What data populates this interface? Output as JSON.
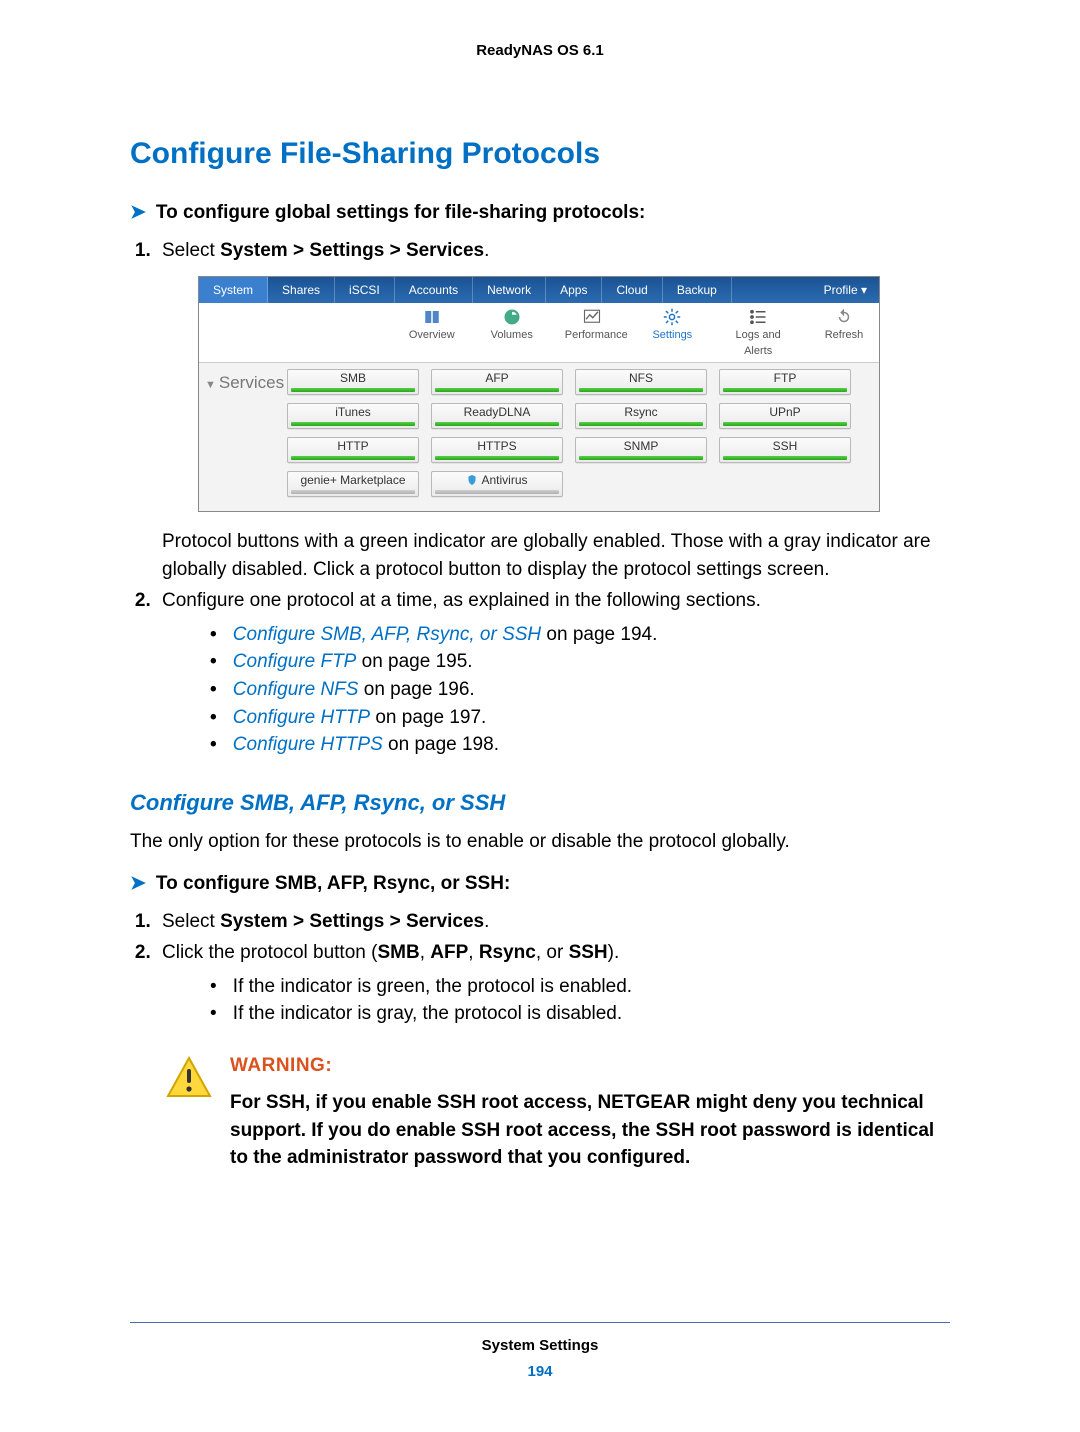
{
  "header": "ReadyNAS OS 6.1",
  "h1": "Configure File-Sharing Protocols",
  "proc1_intro": "To configure global settings for file-sharing protocols:",
  "step1_prefix": "Select ",
  "step1_bold": "System > Settings > Services",
  "step1_suffix": ".",
  "note_after_image": "Protocol buttons with a green indicator are globally enabled. Those with a gray indicator are globally disabled. Click a protocol button to display the protocol settings screen.",
  "step2": "Configure one protocol at a time, as explained in the following sections.",
  "links": [
    {
      "text": "Configure SMB, AFP, Rsync, or SSH",
      "suffix": " on page 194."
    },
    {
      "text": "Configure FTP",
      "suffix": " on page 195."
    },
    {
      "text": "Configure NFS",
      "suffix": " on page 196."
    },
    {
      "text": "Configure HTTP",
      "suffix": " on page 197."
    },
    {
      "text": "Configure HTTPS",
      "suffix": " on page 198."
    }
  ],
  "h2": "Configure SMB, AFP, Rsync, or SSH",
  "h2_body": "The only option for these protocols is to enable or disable the protocol globally.",
  "proc2_intro": "To configure SMB, AFP, Rsync, or SSH:",
  "proc2_step1_prefix": "Select ",
  "proc2_step1_bold": "System > Settings > Services",
  "proc2_step1_suffix": ".",
  "proc2_step2_prefix": "Click the protocol button (",
  "proc2_step2_bold1": "SMB",
  "proc2_step2_mid1": ", ",
  "proc2_step2_bold2": "AFP",
  "proc2_step2_mid2": ", ",
  "proc2_step2_bold3": "Rsync",
  "proc2_step2_mid3": ", or ",
  "proc2_step2_bold4": "SSH",
  "proc2_step2_suffix": ").",
  "sub_a": "If the indicator is green, the protocol is enabled.",
  "sub_b": "If the indicator is gray, the protocol is disabled.",
  "warning_label": "WARNING:",
  "warning_body": "For SSH, if you enable SSH root access, NETGEAR might deny you technical support. If you do enable SSH root access, the SSH root password is identical to the administrator password that you configured.",
  "footer_title": "System Settings",
  "footer_page": "194",
  "ui": {
    "tabs": [
      "System",
      "Shares",
      "iSCSI",
      "Accounts",
      "Network",
      "Apps",
      "Cloud",
      "Backup"
    ],
    "profile": "Profile ▾",
    "toolbar": [
      {
        "label": "Overview"
      },
      {
        "label": "Volumes"
      },
      {
        "label": "Performance"
      },
      {
        "label": "Settings",
        "selected": true
      },
      {
        "label": "Logs and Alerts"
      }
    ],
    "toolbar_right": {
      "label": "Refresh"
    },
    "services_label": "Services",
    "protocols": [
      {
        "name": "SMB",
        "on": true
      },
      {
        "name": "AFP",
        "on": true
      },
      {
        "name": "NFS",
        "on": true
      },
      {
        "name": "FTP",
        "on": true
      },
      {
        "name": "iTunes",
        "on": true
      },
      {
        "name": "ReadyDLNA",
        "on": true
      },
      {
        "name": "Rsync",
        "on": true
      },
      {
        "name": "UPnP",
        "on": true
      },
      {
        "name": "HTTP",
        "on": true
      },
      {
        "name": "HTTPS",
        "on": true
      },
      {
        "name": "SNMP",
        "on": true
      },
      {
        "name": "SSH",
        "on": true
      },
      {
        "name": "genie+ Marketplace",
        "on": false
      },
      {
        "name": "Antivirus",
        "on": false,
        "icon": true
      }
    ]
  }
}
